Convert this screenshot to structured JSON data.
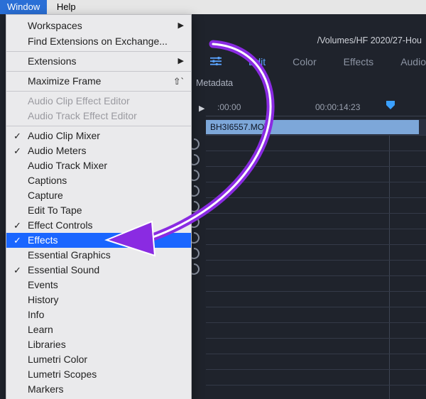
{
  "menubar": {
    "window": "Window",
    "help": "Help"
  },
  "path": "/Volumes/HF 2020/27-Hou",
  "tabs": {
    "edit": "Edit",
    "color": "Color",
    "effects": "Effects",
    "audio": "Audio"
  },
  "metadata_label": "Metadata",
  "timeline": {
    "tc1": ":00:00",
    "tc2": "00:00:14:23",
    "clip_name": "BH3I6557.MOV"
  },
  "menu": {
    "workspaces": "Workspaces",
    "find_ext": "Find Extensions on Exchange...",
    "extensions": "Extensions",
    "maximize": "Maximize Frame",
    "maximize_shortcut": "⇧`",
    "audio_clip_effect_editor": "Audio Clip Effect Editor",
    "audio_track_effect_editor": "Audio Track Effect Editor",
    "audio_clip_mixer": "Audio Clip Mixer",
    "audio_meters": "Audio Meters",
    "audio_track_mixer": "Audio Track Mixer",
    "captions": "Captions",
    "capture": "Capture",
    "edit_to_tape": "Edit To Tape",
    "effect_controls": "Effect Controls",
    "effects": "Effects",
    "essential_graphics": "Essential Graphics",
    "essential_sound": "Essential Sound",
    "events": "Events",
    "history": "History",
    "info": "Info",
    "learn": "Learn",
    "libraries": "Libraries",
    "lumetri_color": "Lumetri Color",
    "lumetri_scopes": "Lumetri Scopes",
    "markers": "Markers"
  },
  "checks": {
    "audio_clip_mixer": "✓",
    "audio_meters": "✓",
    "effect_controls": "✓",
    "effects": "✓",
    "essential_sound": "✓"
  }
}
